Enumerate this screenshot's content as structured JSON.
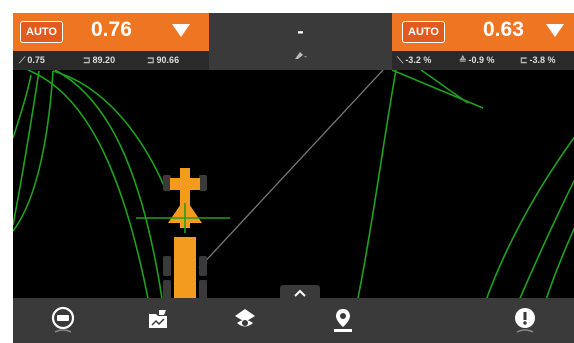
{
  "left_panel": {
    "mode": "AUTO",
    "value": "0.76",
    "stats": [
      {
        "icon": "slope-icon",
        "glyph": "⟋",
        "text": "0.75"
      },
      {
        "icon": "blade-left-icon",
        "glyph": "⊐",
        "text": "89.20"
      },
      {
        "icon": "blade-right-icon",
        "glyph": "⊐",
        "text": "90.66"
      }
    ]
  },
  "center_panel": {
    "value": "-",
    "sub_icon": "blade-angle-icon",
    "sub_text": "-"
  },
  "right_panel": {
    "mode": "AUTO",
    "value": "0.63",
    "stats": [
      {
        "icon": "cross-slope-icon",
        "glyph": "⟍",
        "text": "-3.2 %"
      },
      {
        "icon": "main-slope-icon",
        "glyph": "≙",
        "text": "-0.9 %"
      },
      {
        "icon": "blade-slope-icon",
        "glyph": "⊏",
        "text": "-3.8 %"
      }
    ]
  },
  "toolbar": {
    "items": [
      "keyboard-menu-icon",
      "design-file-icon",
      "view-eye-icon",
      "location-pin-icon",
      "alert-icon"
    ]
  },
  "colors": {
    "accent": "#ee7623",
    "design_lines": "#1fa21f",
    "machine": "#f39b1c",
    "background": "#000000"
  }
}
